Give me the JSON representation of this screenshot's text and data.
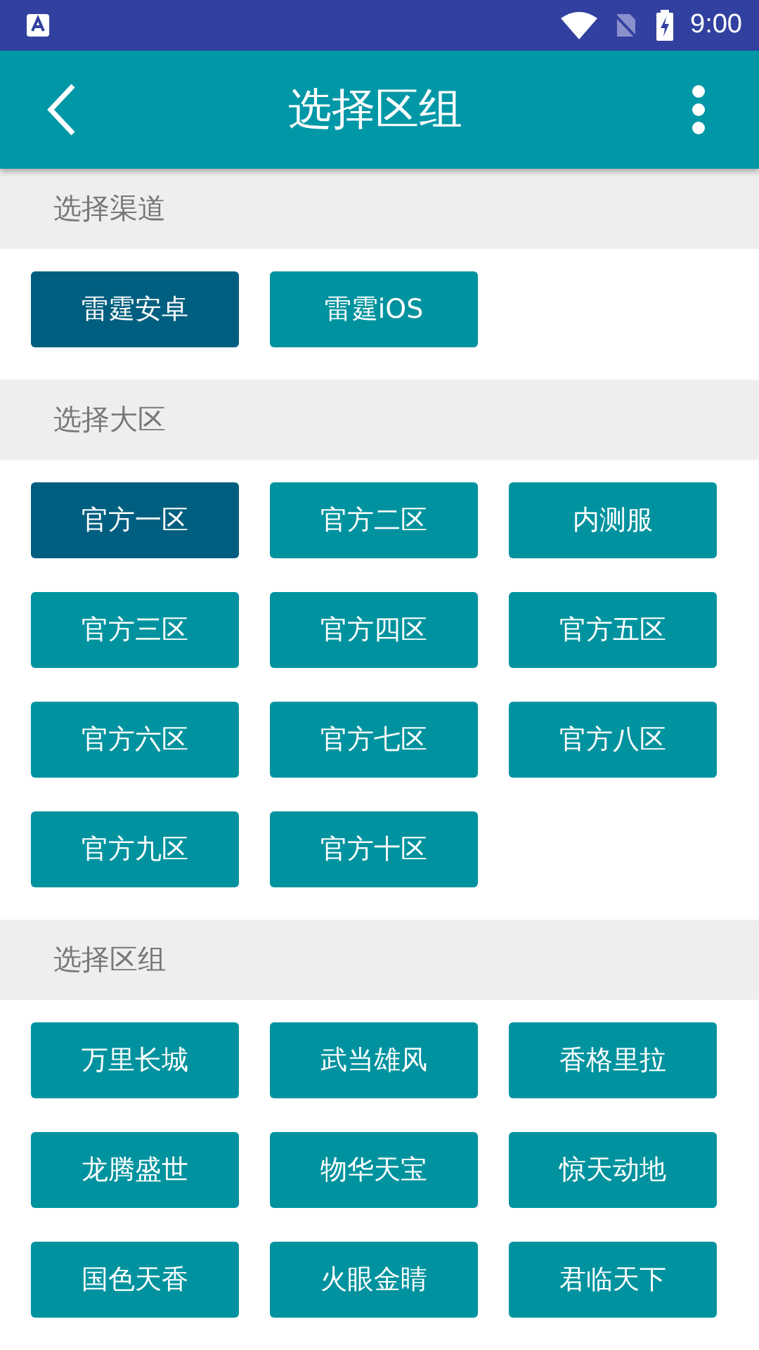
{
  "status_bar": {
    "time": "9:00"
  },
  "app_bar": {
    "title": "选择区组"
  },
  "sections": [
    {
      "title": "选择渠道",
      "options": [
        {
          "label": "雷霆安卓",
          "selected": true
        },
        {
          "label": "雷霆iOS",
          "selected": false
        }
      ]
    },
    {
      "title": "选择大区",
      "options": [
        {
          "label": "官方一区",
          "selected": true
        },
        {
          "label": "官方二区",
          "selected": false
        },
        {
          "label": "内测服",
          "selected": false
        },
        {
          "label": "官方三区",
          "selected": false
        },
        {
          "label": "官方四区",
          "selected": false
        },
        {
          "label": "官方五区",
          "selected": false
        },
        {
          "label": "官方六区",
          "selected": false
        },
        {
          "label": "官方七区",
          "selected": false
        },
        {
          "label": "官方八区",
          "selected": false
        },
        {
          "label": "官方九区",
          "selected": false
        },
        {
          "label": "官方十区",
          "selected": false
        }
      ]
    },
    {
      "title": "选择区组",
      "options": [
        {
          "label": "万里长城",
          "selected": false
        },
        {
          "label": "武当雄风",
          "selected": false
        },
        {
          "label": "香格里拉",
          "selected": false
        },
        {
          "label": "龙腾盛世",
          "selected": false
        },
        {
          "label": "物华天宝",
          "selected": false
        },
        {
          "label": "惊天动地",
          "selected": false
        },
        {
          "label": "国色天香",
          "selected": false
        },
        {
          "label": "火眼金睛",
          "selected": false
        },
        {
          "label": "君临天下",
          "selected": false
        }
      ]
    }
  ]
}
